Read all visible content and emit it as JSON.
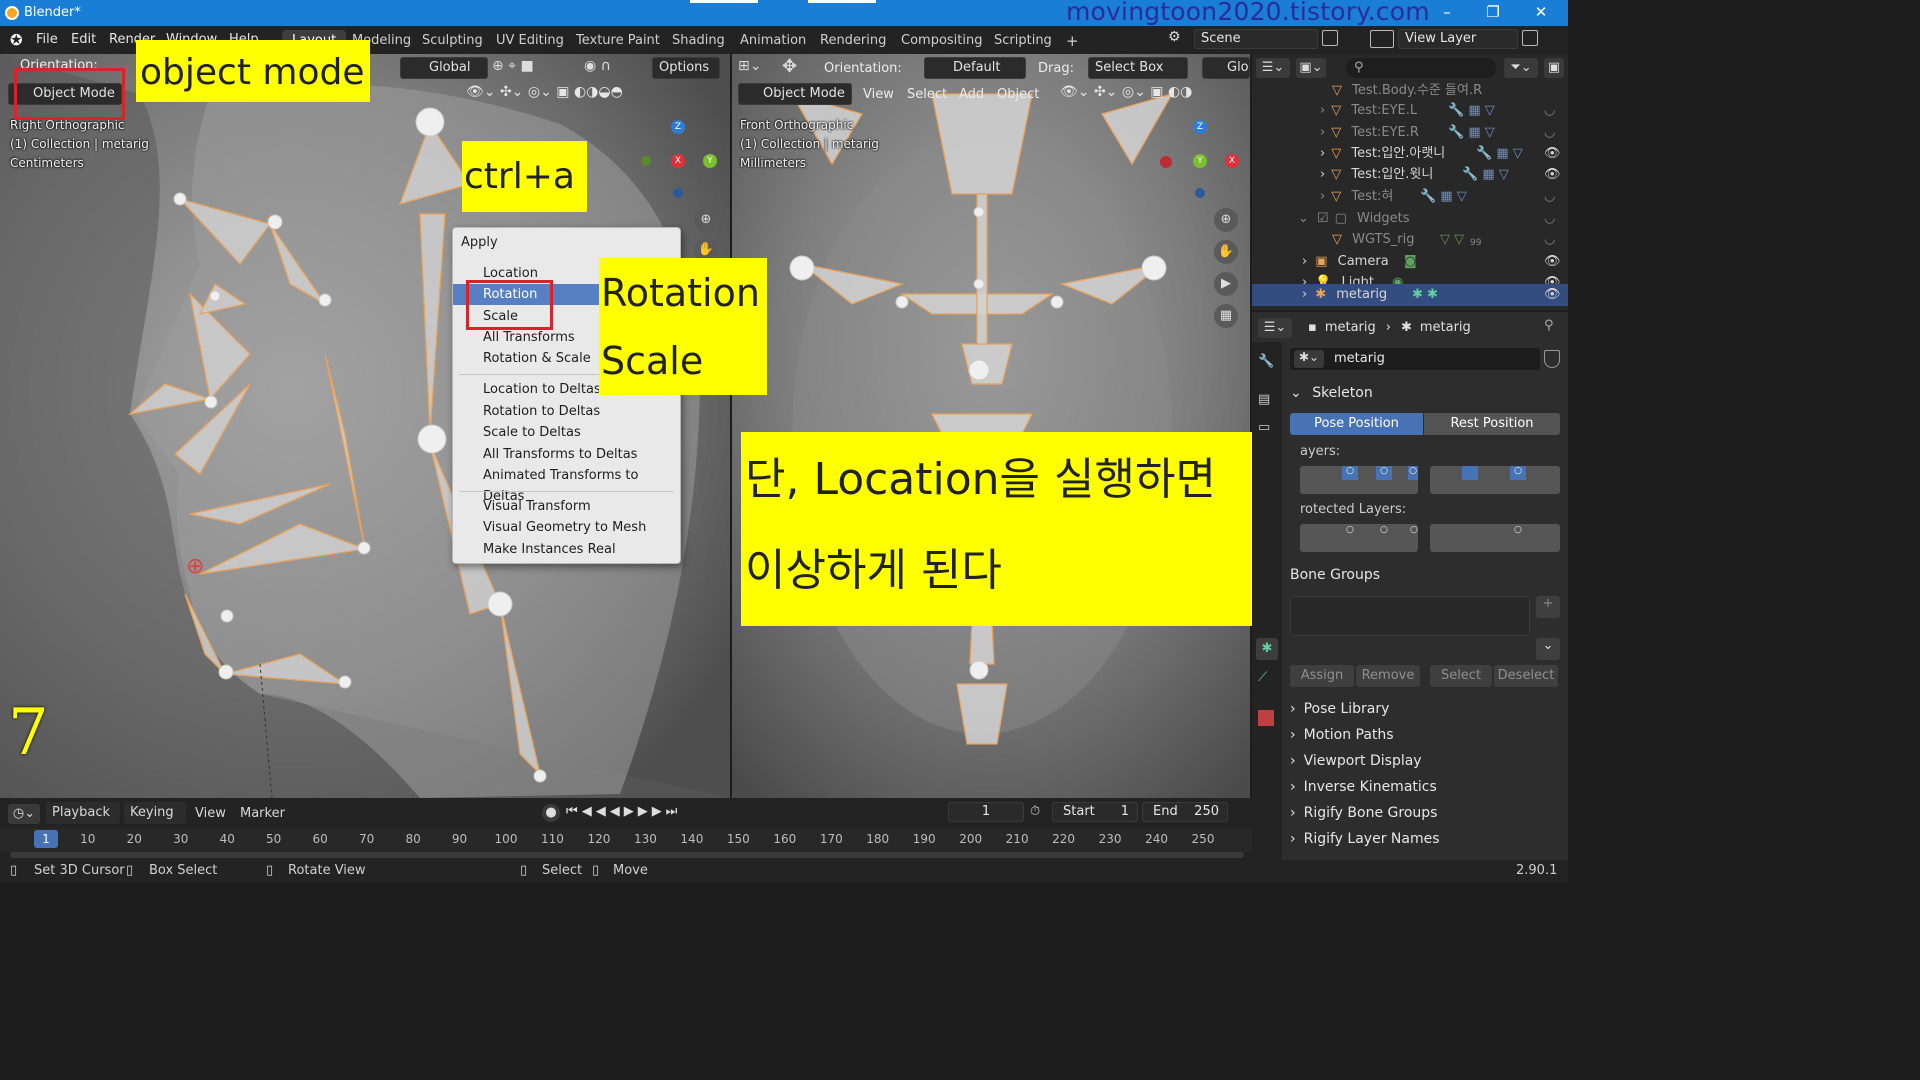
{
  "window": {
    "title": "Blender*",
    "watermark": "movingtoon2020.tistory.com",
    "controls": [
      "–",
      "❐",
      "✕"
    ]
  },
  "menubar": [
    "File",
    "Edit",
    "Render",
    "Window",
    "Help"
  ],
  "workspace_tabs": [
    "Layout",
    "Modeling",
    "Sculpting",
    "UV Editing",
    "Texture Paint",
    "Shading",
    "Animation",
    "Rendering",
    "Compositing",
    "Scripting"
  ],
  "workspace_add": "+",
  "scene": {
    "scene_name": "Scene",
    "view_layer": "View Layer"
  },
  "left_viewport": {
    "orientation_label": "Orientation:",
    "orientation_value": "Global",
    "options_label": "Options",
    "mode_button": "Object Mode",
    "overlay_lines": [
      "Right Orthographic",
      "(1) Collection | metarig",
      "Centimeters"
    ],
    "gizmo_axes": {
      "z": "Z",
      "x": "X",
      "y": "Y"
    }
  },
  "right_viewport": {
    "orientation_label": "Orientation:",
    "orientation_value": "Default",
    "drag_label": "Drag:",
    "drag_value": "Select Box",
    "glo": "Glo",
    "mode_button": "Object Mode",
    "menus": [
      "View",
      "Select",
      "Add",
      "Object"
    ],
    "overlay_lines": [
      "Front Orthographic",
      "(1) Collection | metarig",
      "Millimeters"
    ],
    "gizmo_axes": {
      "z": "Z",
      "x": "X",
      "y": "Y"
    }
  },
  "apply_menu": {
    "title": "Apply",
    "group1": [
      "Location",
      "Rotation",
      "Scale",
      "All Transforms",
      "Rotation & Scale"
    ],
    "group2": [
      "Location to Deltas",
      "Rotation to Deltas",
      "Scale to Deltas",
      "All Transforms to Deltas",
      "Animated Transforms to Deltas"
    ],
    "group3": [
      "Visual Transform",
      "Visual Geometry to Mesh",
      "Make Instances Real"
    ],
    "highlighted": "Rotation"
  },
  "annotations": {
    "object_mode": "object mode",
    "shortcut": "ctrl+a",
    "rotation": "Rotation",
    "scale": "Scale",
    "warning_line1": "단, Location을 실행하면",
    "warning_line2": "이상하게 된다",
    "step_number": "7"
  },
  "outliner": {
    "rows": [
      {
        "name": "Test.Body.수준 들여.R",
        "dim": true
      },
      {
        "name": "Test:EYE.L",
        "dim": true
      },
      {
        "name": "Test:EYE.R",
        "dim": true
      },
      {
        "name": "Test:입안.아랫니",
        "dim": false
      },
      {
        "name": "Test:입안.윗니",
        "dim": false
      },
      {
        "name": "Test:혀",
        "dim": true
      },
      {
        "name": "Widgets",
        "dim": true
      },
      {
        "name": "WGTS_rig",
        "dim": true
      },
      {
        "name": "Camera",
        "dim": false
      },
      {
        "name": "Light",
        "dim": false
      },
      {
        "name": "metarig",
        "dim": false,
        "selected": true
      }
    ],
    "wgts_count": "99"
  },
  "properties": {
    "breadcrumb_object": "metarig",
    "breadcrumb_data": "metarig",
    "data_name": "metarig",
    "skeleton_label": "Skeleton",
    "pose_position": "Pose Position",
    "rest_position": "Rest Position",
    "layers_label": "ayers:",
    "protected_layers_label": "rotected Layers:",
    "bone_groups_label": "Bone Groups",
    "assign": "Assign",
    "remove": "Remove",
    "select": "Select",
    "deselect": "Deselect",
    "panels": [
      "Pose Library",
      "Motion Paths",
      "Viewport Display",
      "Inverse Kinematics",
      "Rigify Bone Groups",
      "Rigify Layer Names"
    ]
  },
  "timeline": {
    "playback": "Playback",
    "keying": "Keying",
    "view": "View",
    "marker": "Marker",
    "current_frame": "1",
    "start_label": "Start",
    "start_value": "1",
    "end_label": "End",
    "end_value": "250",
    "ruler": [
      "1",
      "10",
      "20",
      "30",
      "40",
      "50",
      "60",
      "70",
      "80",
      "90",
      "100",
      "110",
      "120",
      "130",
      "140",
      "150",
      "160",
      "170",
      "180",
      "190",
      "200",
      "210",
      "220",
      "230",
      "240",
      "250"
    ]
  },
  "statusbar": {
    "set_cursor": "Set 3D Cursor",
    "box_select": "Box Select",
    "rotate_view": "Rotate View",
    "select": "Select",
    "move": "Move",
    "version": "2.90.1"
  }
}
